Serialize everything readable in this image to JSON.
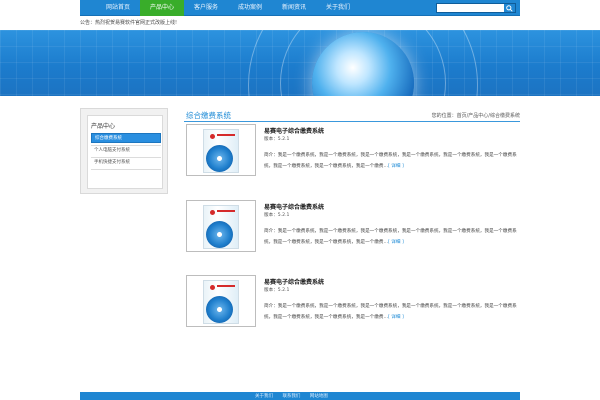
{
  "nav": {
    "items": [
      "网站首页",
      "产品中心",
      "客户服务",
      "成功案例",
      "新闻资讯",
      "关于我们"
    ],
    "active_index": 1,
    "search_placeholder": ""
  },
  "notice": "公告：热烈祝贺易赛软件官网正式改版上线!",
  "sidebar": {
    "title": "产品中心",
    "items": [
      "综合缴费系统",
      "个人电脑支付系统",
      "手机快捷支付系统"
    ],
    "active_index": 0
  },
  "main": {
    "title": "综合缴费系统",
    "breadcrumb": "您的位置：首页/产品中心/综合缴费系统"
  },
  "products": [
    {
      "title": "易赛电子综合缴费系统",
      "version": "版本：5.2.1",
      "desc": "简介：我是一个缴费系统，我是一个缴费系统，我是一个缴费系统，我是一个缴费系统，我是一个缴费系统，我是一个缴费系统，我是一个缴费系统，我是一个缴费系统，我是一个缴费…",
      "more_label": "[ 详细 ]"
    },
    {
      "title": "易赛电子综合缴费系统",
      "version": "版本：5.2.1",
      "desc": "简介：我是一个缴费系统，我是一个缴费系统，我是一个缴费系统，我是一个缴费系统，我是一个缴费系统，我是一个缴费系统，我是一个缴费系统，我是一个缴费系统，我是一个缴费…",
      "more_label": "[ 详细 ]"
    },
    {
      "title": "易赛电子综合缴费系统",
      "version": "版本：5.2.1",
      "desc": "简介：我是一个缴费系统，我是一个缴费系统，我是一个缴费系统，我是一个缴费系统，我是一个缴费系统，我是一个缴费系统，我是一个缴费系统，我是一个缴费系统，我是一个缴费…",
      "more_label": "[ 详细 ]"
    }
  ],
  "footer": {
    "links": [
      "关于我们",
      "联系我们",
      "网站地图"
    ]
  },
  "colors": {
    "nav_blue": "#1f86d2",
    "active_green": "#39ad2a",
    "accent_blue": "#1e8bd6"
  },
  "icons": {
    "search": "search-icon"
  }
}
